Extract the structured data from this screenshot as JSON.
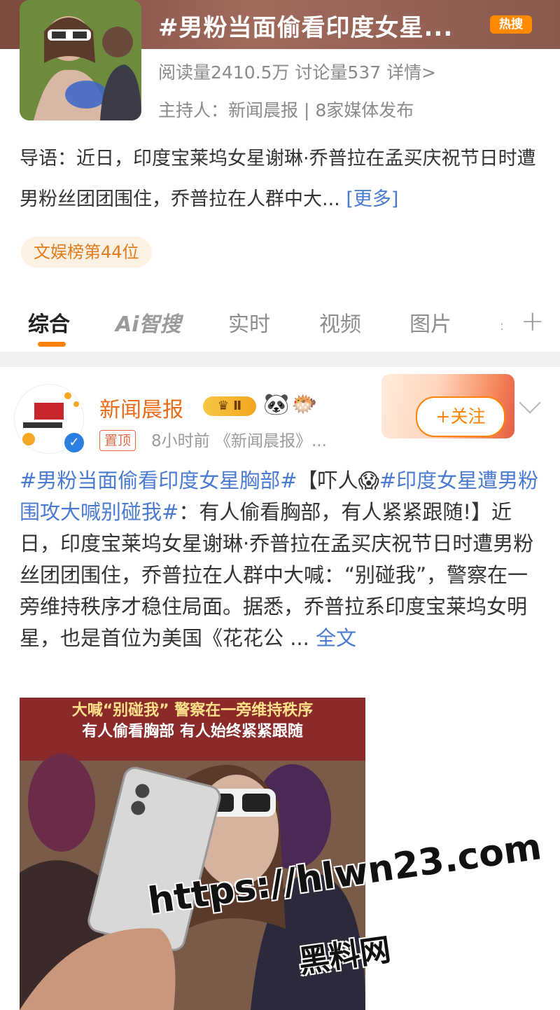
{
  "topic": {
    "title": "#男粉当面偷看印度女星...",
    "hot_badge": "热搜",
    "stats": "阅读量2410.5万  讨论量537  详情>",
    "host": "主持人：新闻晨报 | 8家媒体发布",
    "intro_text": "导语：近日，印度宝莱坞女星谢琳·乔普拉在孟买庆祝节日时遭男粉丝团团围住，乔普拉在人群中大... ",
    "intro_more": "[更多]",
    "rank": "文娱榜第44位"
  },
  "tabs": [
    {
      "label": "综合"
    },
    {
      "label": "Ai智搜"
    },
    {
      "label": "实时"
    },
    {
      "label": "视频"
    },
    {
      "label": "图片"
    }
  ],
  "tab_plus": "+",
  "post": {
    "author": "新闻晨报",
    "vip_level": "Ⅱ",
    "pin": "置顶",
    "meta": "8小时前  《新闻晨报》...",
    "follow": "+关注",
    "hashtag1": "#男粉当面偷看印度女星胸部#",
    "text1": "【吓人😱",
    "hashtag2": "#印度女星遭男粉围攻大喊别碰我#",
    "text2": "：有人偷看胸部，有人紧紧跟随!】近日，印度宝莱坞女星谢琳·乔普拉在孟买庆祝节日时遭男粉丝团团围住，乔普拉在人群中大喊：“别碰我”，警察在一旁维持秩序才稳住局面。据悉，乔普拉系印度宝莱坞女明星，也是首位为美国《花花公 ... ",
    "full_text": "全文",
    "image_caption1": "大喊“别碰我” 警察在一旁维持秩序",
    "image_caption2": "有人偷看胸部 有人始终紧紧跟随"
  },
  "watermark": {
    "url": "https://hlwn23.com",
    "name": "黑料网"
  }
}
